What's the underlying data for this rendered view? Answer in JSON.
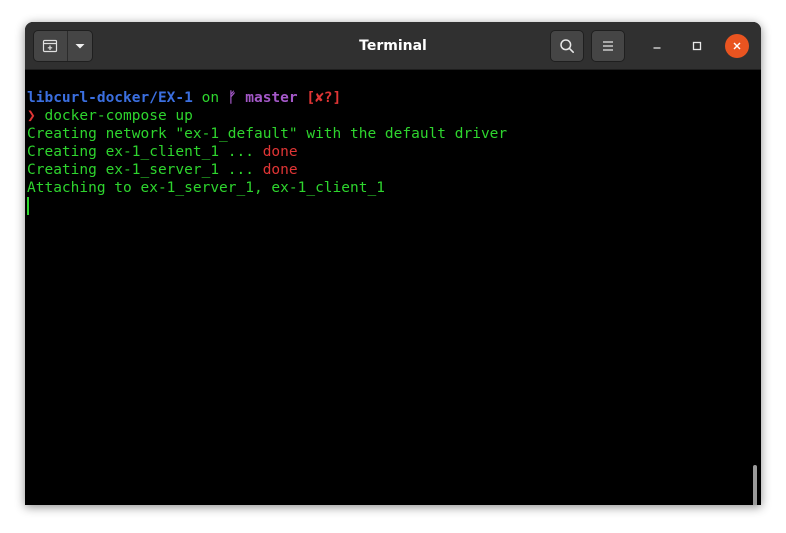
{
  "window": {
    "title": "Terminal"
  },
  "icons": {
    "new_tab": "new-tab-icon",
    "dropdown": "chevron-down-icon",
    "search": "search-icon",
    "menu": "hamburger-menu-icon",
    "minimize": "minimize-icon",
    "maximize": "maximize-icon",
    "close": "close-icon"
  },
  "colors": {
    "path": "#3b6fe0",
    "output": "#2ed52e",
    "branch": "#a458c8",
    "status": "#e03535",
    "close_button": "#e95420"
  },
  "terminal": {
    "prompt": {
      "path": "libcurl-docker/EX-1",
      "on": " on ",
      "branch_icon": "ᚠ",
      "branch": " master",
      "status": " [✘?]"
    },
    "command": {
      "symbol": "❯",
      "text": " docker-compose up"
    },
    "lines": [
      {
        "text": "Creating network \"ex-1_default\" with the default driver",
        "suffix": ""
      },
      {
        "text": "Creating ex-1_client_1 ... ",
        "suffix": "done"
      },
      {
        "text": "Creating ex-1_server_1 ... ",
        "suffix": "done"
      },
      {
        "text": "Attaching to ex-1_server_1, ex-1_client_1",
        "suffix": ""
      }
    ]
  }
}
